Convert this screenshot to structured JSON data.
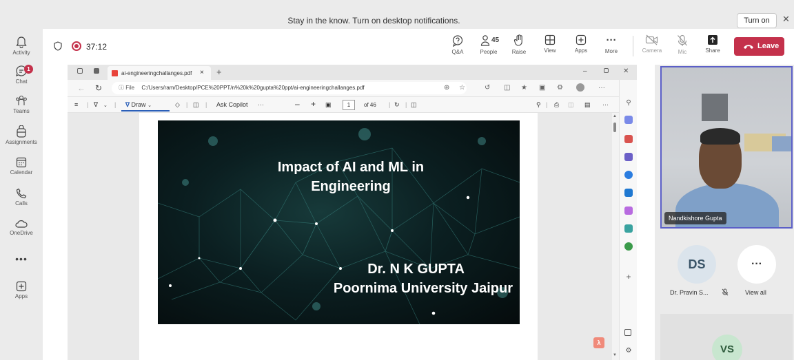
{
  "banner": {
    "text": "Stay in the know. Turn on desktop notifications.",
    "turn_on_label": "Turn on",
    "close_glyph": "✕"
  },
  "rail": {
    "items": [
      {
        "label": "Activity",
        "icon": "bell-icon"
      },
      {
        "label": "Chat",
        "icon": "chat-icon",
        "badge": "1"
      },
      {
        "label": "Teams",
        "icon": "teams-icon"
      },
      {
        "label": "Assignments",
        "icon": "backpack-icon"
      },
      {
        "label": "Calendar",
        "icon": "calendar-icon"
      },
      {
        "label": "Calls",
        "icon": "phone-icon"
      },
      {
        "label": "OneDrive",
        "icon": "cloud-icon"
      },
      {
        "label": "Apps",
        "icon": "plus-box-icon"
      }
    ],
    "more_glyph": "•••"
  },
  "meeting": {
    "timer": "37:12",
    "buttons": {
      "qa": "Q&A",
      "people": "People",
      "people_count": "45",
      "raise": "Raise",
      "view": "View",
      "apps": "Apps",
      "more": "More",
      "camera": "Camera",
      "mic": "Mic",
      "share": "Share",
      "leave": "Leave"
    },
    "more_glyph": "···"
  },
  "browser": {
    "tab_title": "ai-engineeringchallanges.pdf",
    "tab_close": "×",
    "new_tab": "+",
    "file_label": "ⓘ File",
    "url": "C:/Users/ram/Desktop/PCE%20PPT/n%20k%20gupta%20ppt/ai-engineeringchallanges.pdf",
    "pdf_toolbar": {
      "draw_label": "Draw",
      "ask_copilot": "Ask Copilot",
      "page_number": "1",
      "page_total": "of 46"
    }
  },
  "slide": {
    "title_line1": "Impact of AI and ML in",
    "title_line2": "Engineering",
    "author": "Dr. N K GUPTA",
    "institution": "Poornima University Jaipur"
  },
  "participants": {
    "presenter_name": "Nandkishore Gupta",
    "p1_initials": "DS",
    "p1_name": "Dr. Pravin S...",
    "view_all": "View all",
    "more_glyph": "···",
    "p2_initials": "VS"
  },
  "colors": {
    "leave": "#c4314b",
    "accent": "#5b5fc7",
    "recording": "#c4314b"
  }
}
